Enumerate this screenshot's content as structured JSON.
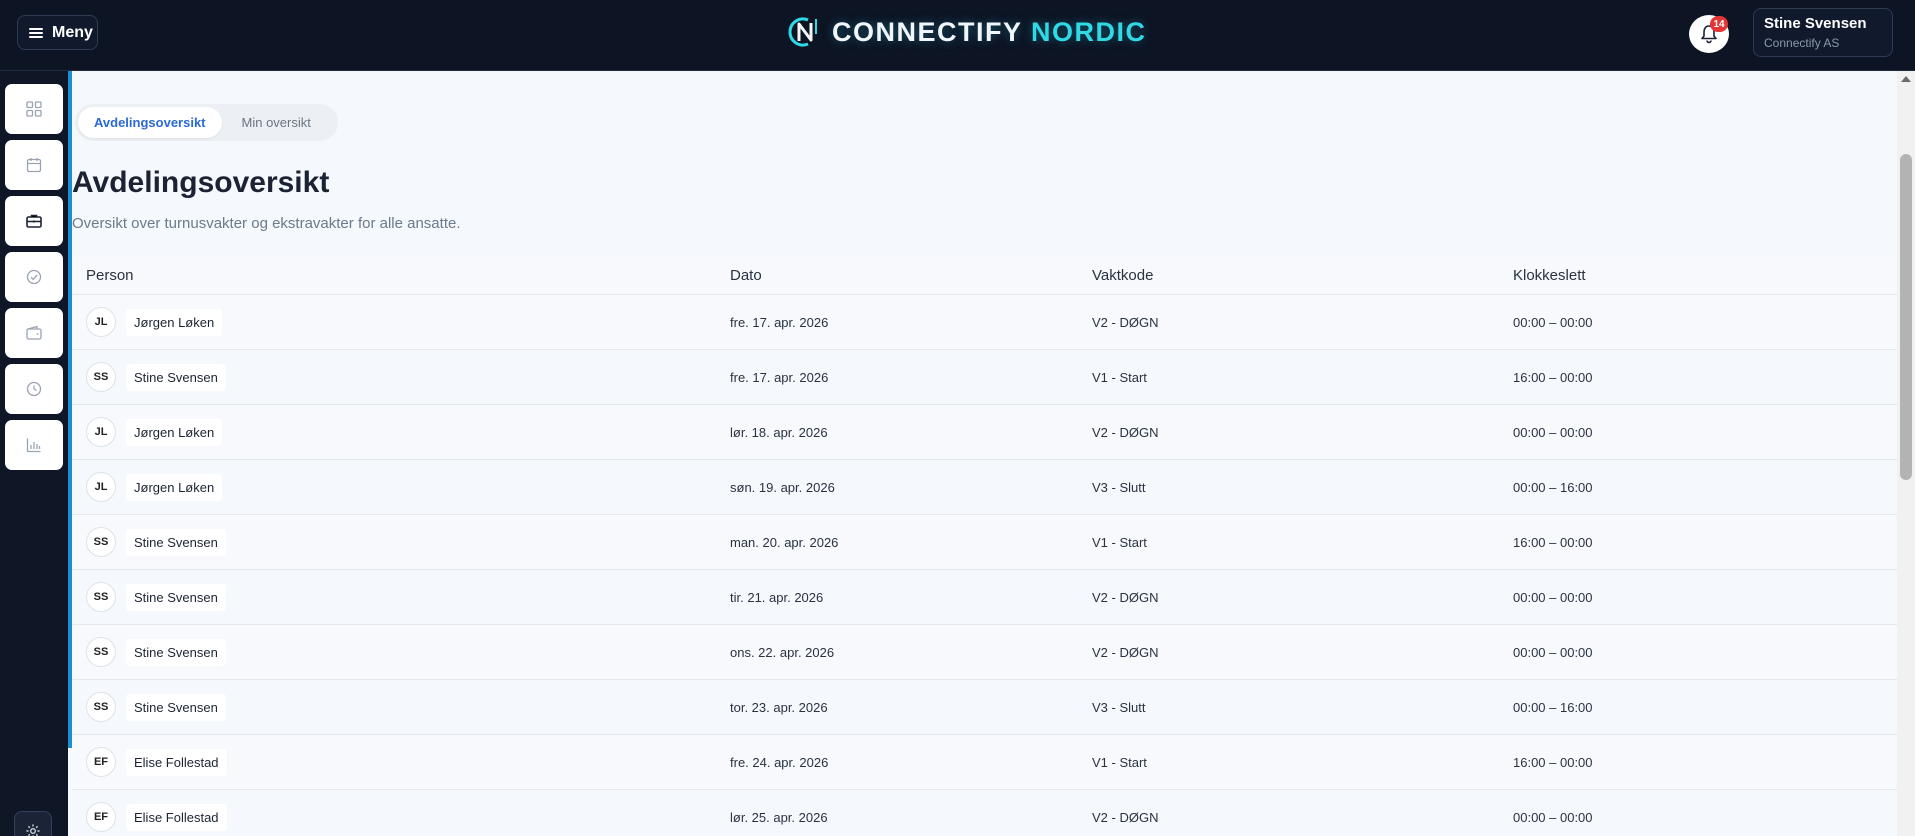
{
  "header": {
    "menu_label": "Meny",
    "brand_main": "CONNECTIFY",
    "brand_accent": "NORDIC",
    "notification_count": "14",
    "user_name": "Stine Svensen",
    "user_company": "Connectify AS"
  },
  "sidebar": {
    "items": [
      {
        "icon": "grid-icon"
      },
      {
        "icon": "calendar-icon"
      },
      {
        "icon": "briefcase-icon",
        "active": true
      },
      {
        "icon": "check-circle-icon"
      },
      {
        "icon": "wallet-icon"
      },
      {
        "icon": "clock-icon"
      },
      {
        "icon": "bar-chart-icon"
      }
    ],
    "settings_icon": "gear-icon"
  },
  "tabs": [
    {
      "label": "Avdelingsoversikt",
      "active": true
    },
    {
      "label": "Min oversikt",
      "active": false
    }
  ],
  "page": {
    "title": "Avdelingsoversikt",
    "subtitle": "Oversikt over turnusvakter og ekstravakter for alle ansatte."
  },
  "table": {
    "headers": {
      "person": "Person",
      "date": "Dato",
      "code": "Vaktkode",
      "time": "Klokkeslett"
    },
    "rows": [
      {
        "initials": "JL",
        "name": "Jørgen Løken",
        "date": "fre. 17. apr. 2026",
        "code": "V2 - DØGN",
        "time": "00:00 – 00:00"
      },
      {
        "initials": "SS",
        "name": "Stine Svensen",
        "date": "fre. 17. apr. 2026",
        "code": "V1 - Start",
        "time": "16:00 – 00:00"
      },
      {
        "initials": "JL",
        "name": "Jørgen Løken",
        "date": "lør. 18. apr. 2026",
        "code": "V2 - DØGN",
        "time": "00:00 – 00:00"
      },
      {
        "initials": "JL",
        "name": "Jørgen Løken",
        "date": "søn. 19. apr. 2026",
        "code": "V3 - Slutt",
        "time": "00:00 – 16:00"
      },
      {
        "initials": "SS",
        "name": "Stine Svensen",
        "date": "man. 20. apr. 2026",
        "code": "V1 - Start",
        "time": "16:00 – 00:00"
      },
      {
        "initials": "SS",
        "name": "Stine Svensen",
        "date": "tir. 21. apr. 2026",
        "code": "V2 - DØGN",
        "time": "00:00 – 00:00"
      },
      {
        "initials": "SS",
        "name": "Stine Svensen",
        "date": "ons. 22. apr. 2026",
        "code": "V2 - DØGN",
        "time": "00:00 – 00:00"
      },
      {
        "initials": "SS",
        "name": "Stine Svensen",
        "date": "tor. 23. apr. 2026",
        "code": "V3 - Slutt",
        "time": "00:00 – 16:00"
      },
      {
        "initials": "EF",
        "name": "Elise Follestad",
        "date": "fre. 24. apr. 2026",
        "code": "V1 - Start",
        "time": "16:00 – 00:00"
      },
      {
        "initials": "EF",
        "name": "Elise Follestad",
        "date": "lør. 25. apr. 2026",
        "code": "V2 - DØGN",
        "time": "00:00 – 00:00"
      }
    ]
  },
  "colors": {
    "topbar_bg": "#0d1424",
    "accent_cyan": "#2fd9e6",
    "active_tab_text": "#2b6ad4",
    "badge": "#e53535",
    "content_accent_bar": "#1f8fd4"
  }
}
